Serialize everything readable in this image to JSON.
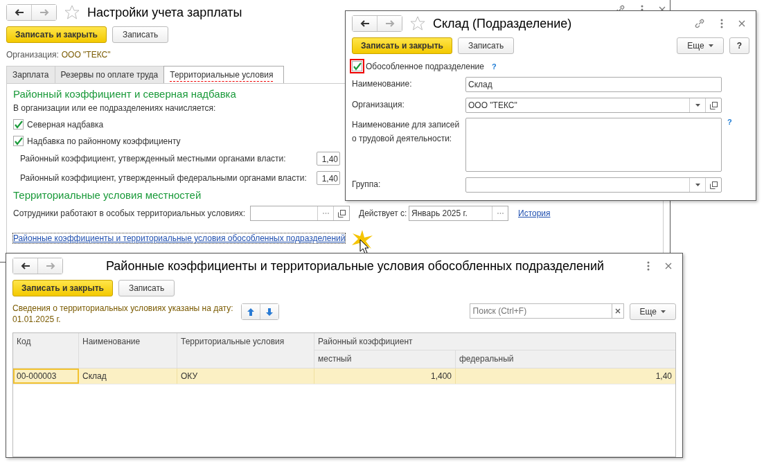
{
  "settings_window": {
    "title": "Настройки учета зарплаты",
    "buttons": [
      {
        "label": "Записать и закрыть",
        "kind": "primary"
      },
      {
        "label": "Записать",
        "kind": "default"
      }
    ],
    "organization": {
      "label": "Организация:",
      "value": "ООО \"ТЕКС\""
    },
    "tabs": [
      {
        "label": "Зарплата",
        "selected": false
      },
      {
        "label": "Резервы по оплате труда",
        "selected": false
      },
      {
        "label": "Территориальные условия",
        "selected": true
      }
    ],
    "section_1": {
      "heading": "Районный коэффициент и северная надбавка",
      "intro": "В организации или ее подразделениях начисляется:",
      "checkboxes": [
        {
          "label": "Северная надбавка",
          "checked": true
        },
        {
          "label": "Надбавка по районному коэффициенту",
          "checked": true
        }
      ],
      "coefficients": [
        {
          "label": "Районный коэффициент, утвержденный местными органами власти:",
          "value": "1,40"
        },
        {
          "label": "Районный коэффициент, утвержденный федеральными органами власти:",
          "value": "1,40"
        }
      ]
    },
    "section_2": {
      "heading": "Территориальные условия местностей",
      "special_label": "Сотрудники работают в особых территориальных условиях:",
      "effective_label": "Действует с:",
      "effective_value": "Январь 2025 г.",
      "history_link": "История"
    },
    "subdivisions_link": "Районные коэффициенты и территориальные условия обособленных подразделений"
  },
  "subdivision_window": {
    "title": "Склад (Подразделение)",
    "buttons": [
      {
        "label": "Записать и закрыть",
        "kind": "primary"
      },
      {
        "label": "Записать",
        "kind": "default"
      }
    ],
    "more_button": "Еще",
    "help_button": "?",
    "separate": {
      "label": "Обособленное подразделение",
      "checked": true,
      "help": "?"
    },
    "fields": [
      {
        "label": "Наименование:",
        "value": "Склад",
        "kind": "text"
      },
      {
        "label": "Организация:",
        "value": "ООО \"ТЕКС\"",
        "kind": "select"
      },
      {
        "label": "Наименование для записей о трудовой деятельности:",
        "kind": "textarea",
        "help": "?"
      },
      {
        "label": "Группа:",
        "kind": "select"
      }
    ]
  },
  "coefficients_window": {
    "title": "Районные коэффициенты и территориальные условия обособленных подразделений",
    "buttons": [
      {
        "label": "Записать и закрыть",
        "kind": "primary"
      },
      {
        "label": "Записать",
        "kind": "default"
      }
    ],
    "date_label": "Сведения о территориальных условиях указаны на дату:",
    "date_value": "01.01.2025 г.",
    "search": {
      "placeholder": "Поиск (Ctrl+F)"
    },
    "more_button": "Еще",
    "table": {
      "columns": [
        "Код",
        "Наименование",
        "Территориальные условия"
      ],
      "group_column": "Районный коэффициент",
      "sub_columns": [
        "местный",
        "федеральный"
      ],
      "rows": [
        {
          "cells": [
            "00-000003",
            "Склад",
            "ОКУ",
            "1,400",
            "1,40"
          ],
          "selected": true
        }
      ]
    }
  }
}
